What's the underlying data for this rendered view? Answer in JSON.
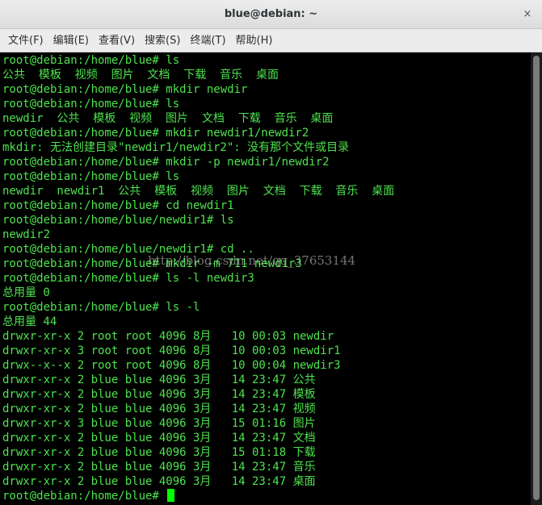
{
  "window": {
    "title": "blue@debian: ~",
    "close_glyph": "×"
  },
  "menu": {
    "items": [
      {
        "label": "文件(F)"
      },
      {
        "label": "编辑(E)"
      },
      {
        "label": "查看(V)"
      },
      {
        "label": "搜索(S)"
      },
      {
        "label": "终端(T)"
      },
      {
        "label": "帮助(H)"
      }
    ]
  },
  "terminal": {
    "lines": [
      "root@debian:/home/blue# ls",
      "公共  模板  视频  图片  文档  下载  音乐  桌面",
      "root@debian:/home/blue# mkdir newdir",
      "root@debian:/home/blue# ls",
      "newdir  公共  模板  视频  图片  文档  下载  音乐  桌面",
      "root@debian:/home/blue# mkdir newdir1/newdir2",
      "mkdir: 无法创建目录\"newdir1/newdir2\": 没有那个文件或目录",
      "root@debian:/home/blue# mkdir -p newdir1/newdir2",
      "root@debian:/home/blue# ls",
      "newdir  newdir1  公共  模板  视频  图片  文档  下载  音乐  桌面",
      "root@debian:/home/blue# cd newdir1",
      "root@debian:/home/blue/newdir1# ls",
      "newdir2",
      "root@debian:/home/blue/newdir1# cd ..",
      "root@debian:/home/blue# mkdir -m 711 newdir3",
      "root@debian:/home/blue# ls -l newdir3",
      "总用量 0",
      "root@debian:/home/blue# ls -l",
      "总用量 44",
      "drwxr-xr-x 2 root root 4096 8月   10 00:03 newdir",
      "drwxr-xr-x 3 root root 4096 8月   10 00:03 newdir1",
      "drwx--x--x 2 root root 4096 8月   10 00:04 newdir3",
      "drwxr-xr-x 2 blue blue 4096 3月   14 23:47 公共",
      "drwxr-xr-x 2 blue blue 4096 3月   14 23:47 模板",
      "drwxr-xr-x 2 blue blue 4096 3月   14 23:47 视频",
      "drwxr-xr-x 3 blue blue 4096 3月   15 01:16 图片",
      "drwxr-xr-x 2 blue blue 4096 3月   14 23:47 文档",
      "drwxr-xr-x 2 blue blue 4096 3月   15 01:18 下载",
      "drwxr-xr-x 2 blue blue 4096 3月   14 23:47 音乐",
      "drwxr-xr-x 2 blue blue 4096 3月   14 23:47 桌面"
    ],
    "prompt": "root@debian:/home/blue# ",
    "text_color": "#4ee24e",
    "background": "#000000"
  },
  "watermark": {
    "text": "http://blog.csdn.net/qq_37653144"
  }
}
